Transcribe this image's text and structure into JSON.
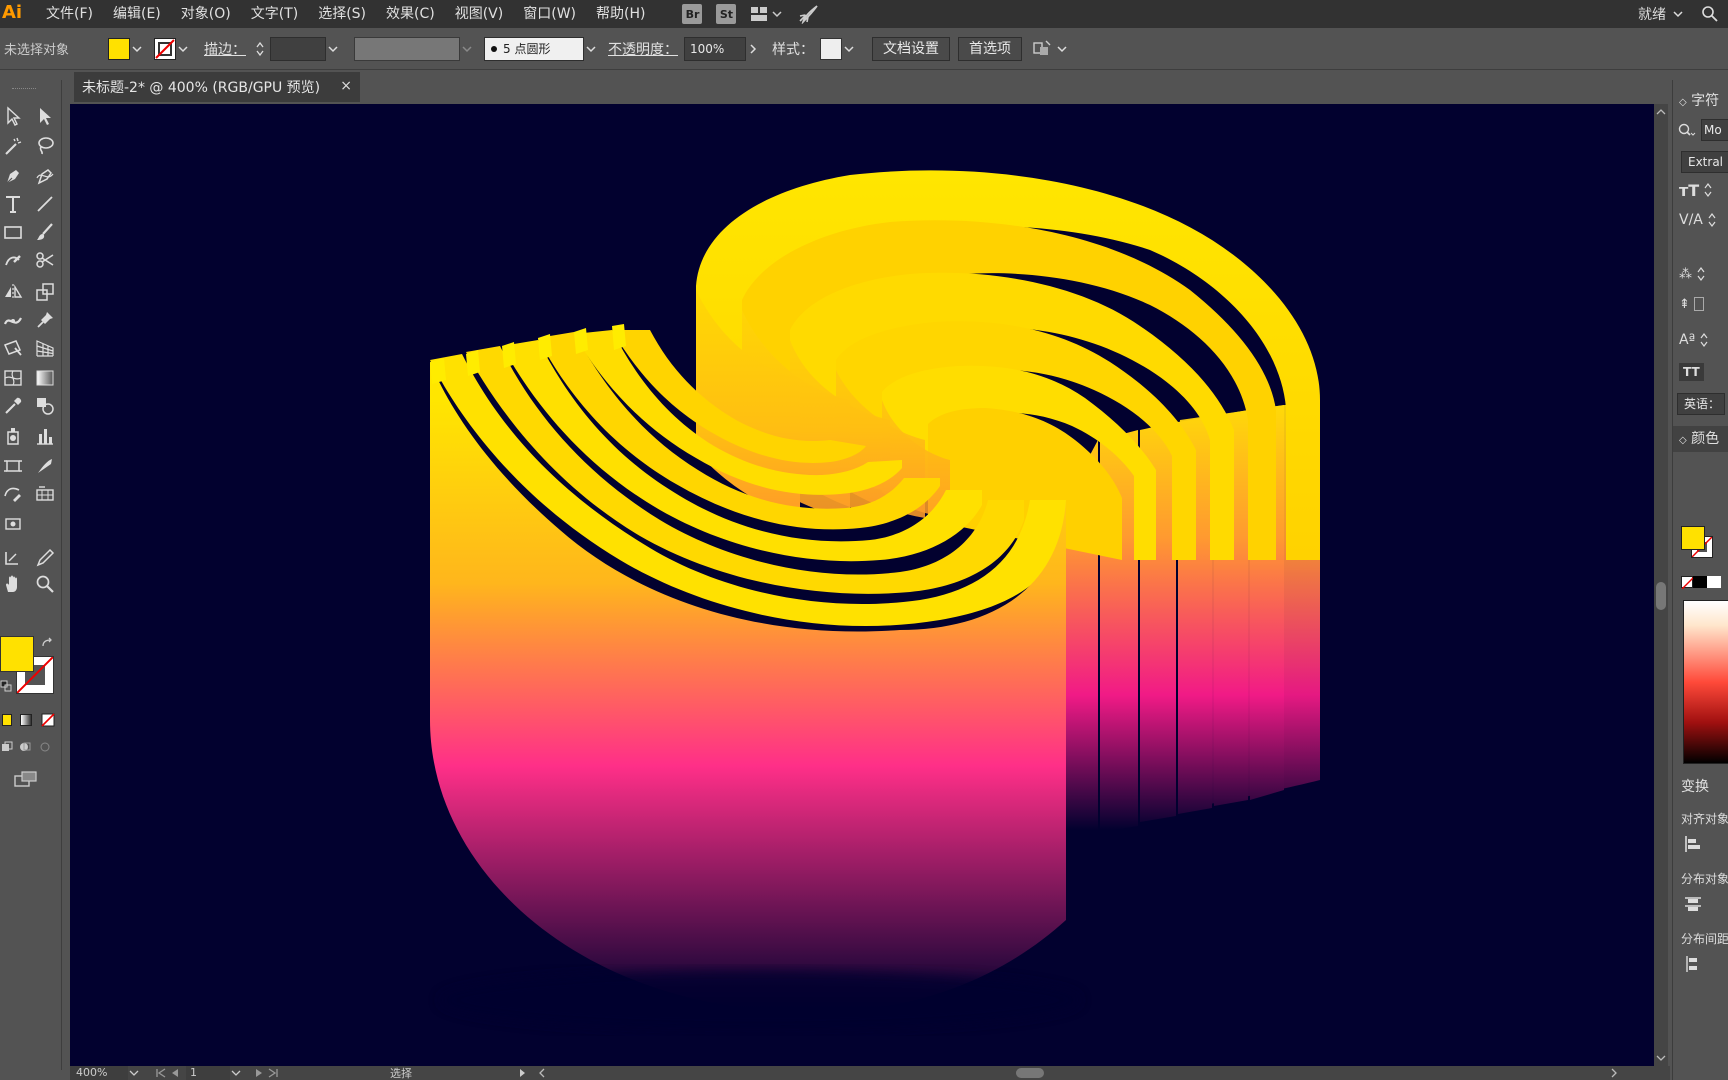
{
  "app": {
    "logo": "Ai"
  },
  "menu": {
    "items": [
      "文件(F)",
      "编辑(E)",
      "对象(O)",
      "文字(T)",
      "选择(S)",
      "效果(C)",
      "视图(V)",
      "窗口(W)",
      "帮助(H)"
    ],
    "bridge_badge": "Br",
    "stock_badge": "St",
    "workspace": "就绪"
  },
  "controlbar": {
    "selection_status": "未选择对象",
    "fill_color": "#ffe100",
    "stroke_label": "描边：",
    "brush_value": "5 点圆形",
    "opacity_label": "不透明度：",
    "opacity_value": "100%",
    "style_label": "样式：",
    "doc_setup_button": "文档设置",
    "preferences_button": "首选项"
  },
  "document_tab": {
    "title": "未标题-2* @ 400% (RGB/GPU 预览)",
    "close": "×"
  },
  "canvas": {
    "background": "#02012f",
    "gradient_colors": [
      "#ffe600",
      "#ffb21a",
      "#ff2a8a",
      "#02012f"
    ]
  },
  "tools": {
    "fill_color": "#ffe100"
  },
  "statusbar": {
    "zoom": "400%",
    "page": "1",
    "tool_name": "选择"
  },
  "rightpanel": {
    "character_title": "字符",
    "font_search": "Mo",
    "font_style": "Extral",
    "language": "英语：",
    "color_title": "颜色",
    "transform_title": "变换",
    "align_objects": "对齐对象",
    "distribute_objects": "分布对象",
    "distribute_spacing": "分布间距",
    "caps_label": "TT"
  }
}
